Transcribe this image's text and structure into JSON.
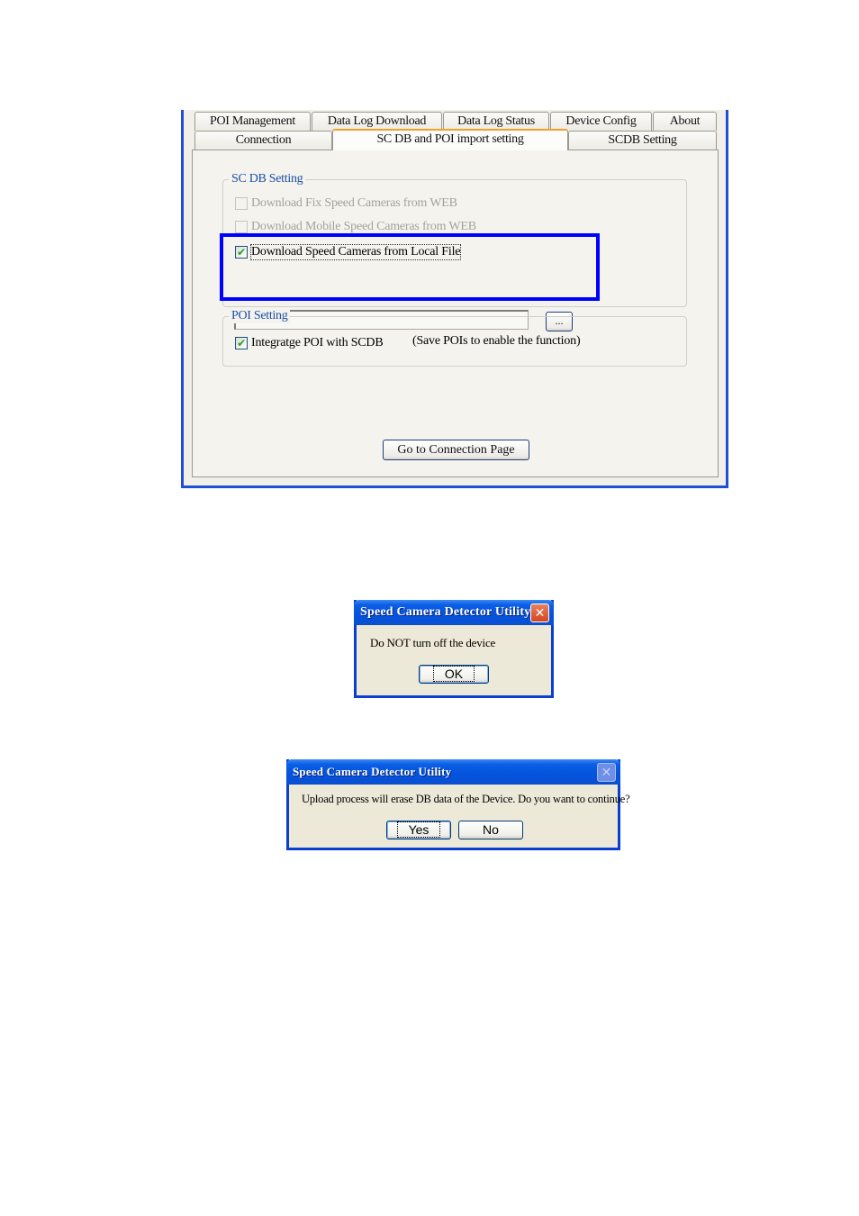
{
  "settings_window": {
    "tabs_row1": [
      "POI Management",
      "Data Log Download",
      "Data Log Status",
      "Device Config",
      "About"
    ],
    "tabs_row2": [
      "Connection",
      "SC DB and POI import setting",
      "SCDB  Setting"
    ],
    "active_tab": "SC DB and POI import setting",
    "scdb_group": {
      "legend": "SC DB  Setting",
      "options": [
        {
          "label": "Download Fix Speed Cameras from WEB",
          "checked": false,
          "enabled": false
        },
        {
          "label": "Download Mobile Speed Cameras from WEB",
          "checked": false,
          "enabled": false
        },
        {
          "label": "Download  Speed Cameras from Local File",
          "checked": true,
          "enabled": true
        }
      ],
      "file_path_value": "",
      "browse_label": "..."
    },
    "poi_group": {
      "legend": "POI Setting",
      "option": {
        "label": "Integratge  POI with  SCDB",
        "checked": true
      },
      "note": "(Save POIs to enable the function)"
    },
    "connection_button": "Go to Connection Page",
    "highlight_color": "#0000ff"
  },
  "dialog_warning": {
    "title": "Speed Camera Detector Utility",
    "message": "Do NOT turn off the device",
    "ok_label": "OK",
    "close_icon": "close-icon"
  },
  "dialog_confirm": {
    "title": "Speed Camera Detector Utility",
    "message": "Upload process will erase DB data of the Device. Do you want to continue?",
    "yes_label": "Yes",
    "no_label": "No",
    "close_icon": "close-icon"
  }
}
